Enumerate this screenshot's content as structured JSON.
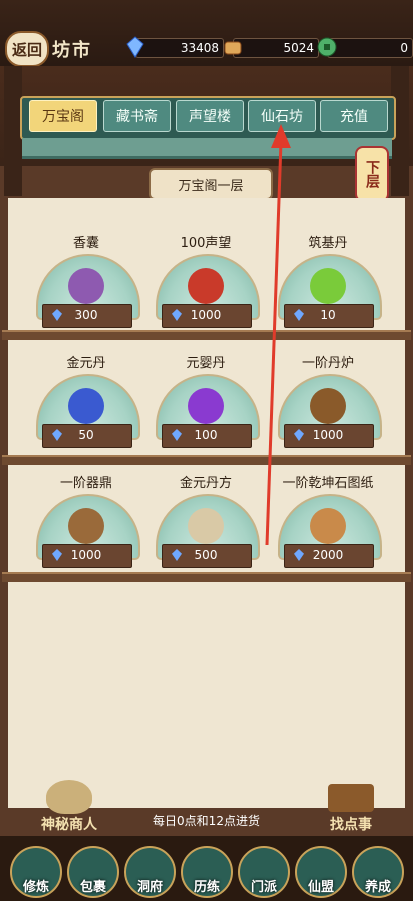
{
  "header": {
    "back_label": "返回",
    "title": "坊市"
  },
  "resources": [
    {
      "icon": "crystal-icon",
      "value": "33408"
    },
    {
      "icon": "gold-ingot-icon",
      "value": "5024"
    },
    {
      "icon": "jade-coin-icon",
      "value": "0"
    }
  ],
  "tabs": [
    {
      "label": "万宝阁",
      "active": true
    },
    {
      "label": "藏书斋",
      "active": false
    },
    {
      "label": "声望楼",
      "active": false
    },
    {
      "label": "仙石坊",
      "active": false
    },
    {
      "label": "充值",
      "active": false
    }
  ],
  "floor": {
    "label": "万宝阁一层",
    "next_floor": "下层"
  },
  "items": [
    {
      "name": "香囊",
      "price": "300",
      "icon": "sachet-icon"
    },
    {
      "name": "100声望",
      "price": "1000",
      "icon": "reputation-token-icon"
    },
    {
      "name": "筑基丹",
      "price": "10",
      "icon": "green-pill-icon"
    },
    {
      "name": "金元丹",
      "price": "50",
      "icon": "blue-orb-icon"
    },
    {
      "name": "元婴丹",
      "price": "100",
      "icon": "purple-orb-icon"
    },
    {
      "name": "一阶丹炉",
      "price": "1000",
      "icon": "furnace-icon"
    },
    {
      "name": "一阶器鼎",
      "price": "1000",
      "icon": "cauldron-icon"
    },
    {
      "name": "金元丹方",
      "price": "500",
      "icon": "recipe-scroll-icon"
    },
    {
      "name": "一阶乾坤石图纸",
      "price": "2000",
      "icon": "blueprint-icon"
    }
  ],
  "footer": {
    "restock_text": "每日0点和12点进货",
    "npc_label": "神秘商人",
    "task_label": "找点事"
  },
  "nav": [
    {
      "label": "修炼"
    },
    {
      "label": "包裹"
    },
    {
      "label": "洞府"
    },
    {
      "label": "历练"
    },
    {
      "label": "门派"
    },
    {
      "label": "仙盟"
    },
    {
      "label": "养成"
    }
  ],
  "colors": {
    "accent_gold": "#f2d57a",
    "tab_teal": "#4f8a80",
    "annotation_red": "#e03b2b"
  }
}
